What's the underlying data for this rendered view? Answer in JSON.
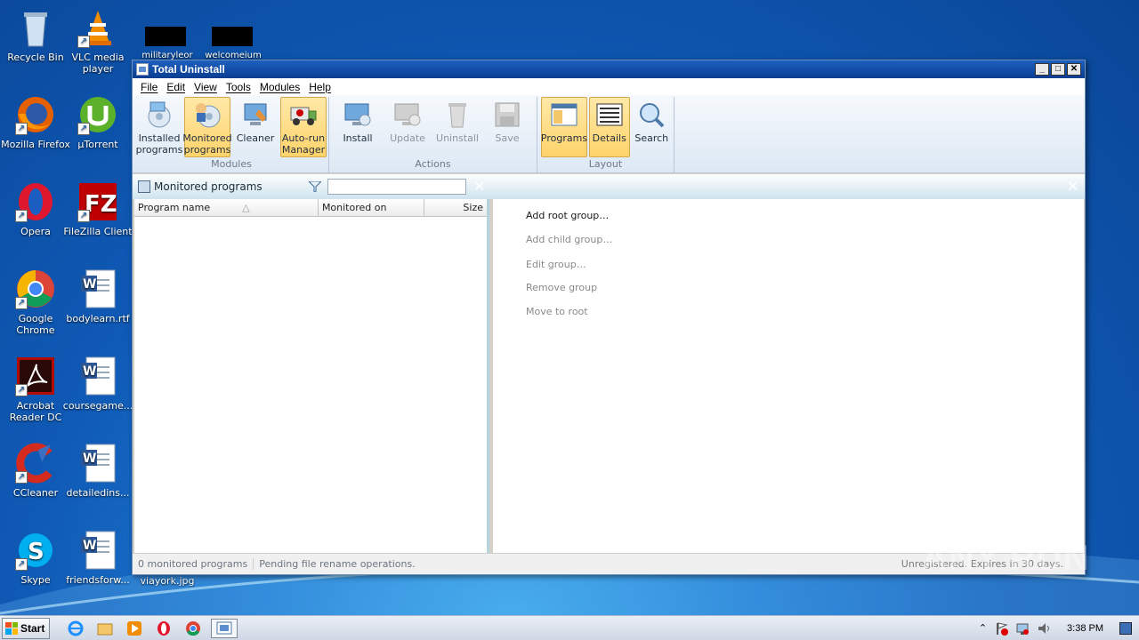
{
  "desktop": {
    "icons": [
      {
        "label": "Recycle Bin"
      },
      {
        "label": "VLC media player"
      },
      {
        "label": "Mozilla Firefox"
      },
      {
        "label": "µTorrent"
      },
      {
        "label": "Opera"
      },
      {
        "label": "FileZilla Client"
      },
      {
        "label": "Google Chrome"
      },
      {
        "label": "bodylearn.rtf"
      },
      {
        "label": "Acrobat Reader DC"
      },
      {
        "label": "coursegame..."
      },
      {
        "label": "CCleaner"
      },
      {
        "label": "detailedins..."
      },
      {
        "label": "Skype"
      },
      {
        "label": "friendsforw..."
      }
    ],
    "partial_labels": [
      "militaryleor",
      "welcomeium",
      "viayork.jpg"
    ]
  },
  "window": {
    "title": "Total Uninstall",
    "controls": {
      "minimize": "_",
      "maximize": "□",
      "close": "✕"
    },
    "menu": [
      "File",
      "Edit",
      "View",
      "Tools",
      "Modules",
      "Help"
    ],
    "ribbon": {
      "groups": [
        {
          "name": "Modules",
          "buttons": [
            {
              "label": "Installed programs",
              "state": "normal",
              "icon": "installed-programs-icon"
            },
            {
              "label": "Monitored programs",
              "state": "active",
              "icon": "monitored-programs-icon"
            },
            {
              "label": "Cleaner",
              "state": "normal",
              "icon": "cleaner-icon"
            },
            {
              "label": "Auto-run Manager",
              "state": "active",
              "icon": "autorun-manager-icon"
            }
          ]
        },
        {
          "name": "Actions",
          "buttons": [
            {
              "label": "Install",
              "state": "normal",
              "icon": "install-icon"
            },
            {
              "label": "Update",
              "state": "disabled",
              "icon": "update-icon"
            },
            {
              "label": "Uninstall",
              "state": "disabled",
              "icon": "uninstall-icon"
            },
            {
              "label": "Save",
              "state": "disabled",
              "icon": "save-icon"
            }
          ]
        },
        {
          "name": "Layout",
          "buttons": [
            {
              "label": "Programs",
              "state": "active",
              "icon": "programs-layout-icon"
            },
            {
              "label": "Details",
              "state": "active",
              "icon": "details-layout-icon"
            },
            {
              "label": "Search",
              "state": "normal",
              "icon": "search-icon"
            }
          ]
        }
      ]
    },
    "subheader": {
      "title": "Monitored programs",
      "filter_value": ""
    },
    "columns": [
      {
        "label": "Program name"
      },
      {
        "label": "Monitored on"
      },
      {
        "label": "Size"
      }
    ],
    "context_actions": [
      {
        "label": "Add root group…",
        "enabled": true
      },
      {
        "label": "Add child group…",
        "enabled": false
      },
      {
        "label": "Edit group…",
        "enabled": false
      },
      {
        "label": "Remove group",
        "enabled": false
      },
      {
        "label": "Move to root",
        "enabled": false
      }
    ],
    "status": {
      "count": "0 monitored programs",
      "message": "Pending file rename operations.",
      "registration": "Unregistered. Expires in 30 days."
    }
  },
  "taskbar": {
    "start_label": "Start",
    "clock": "3:38 PM"
  },
  "watermark": "ANY RUN",
  "colors": {
    "ribbon_active": "#ffd36b",
    "title_bar": "#0a3d91"
  }
}
